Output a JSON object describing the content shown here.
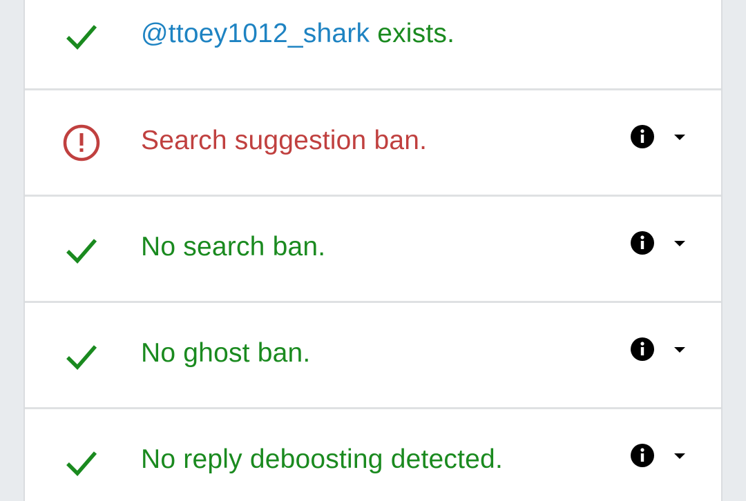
{
  "results": {
    "exists": {
      "status": "ok",
      "icon": "check-icon",
      "username": "@ttoey1012_shark",
      "text": " exists."
    },
    "items": [
      {
        "status": "bad",
        "icon": "alert-circle-icon",
        "text": "Search suggestion ban.",
        "info_icon": "info-icon",
        "expand_icon": "caret-down-icon"
      },
      {
        "status": "ok",
        "icon": "check-icon",
        "text": "No search ban.",
        "info_icon": "info-icon",
        "expand_icon": "caret-down-icon"
      },
      {
        "status": "ok",
        "icon": "check-icon",
        "text": "No ghost ban.",
        "info_icon": "info-icon",
        "expand_icon": "caret-down-icon"
      },
      {
        "status": "ok",
        "icon": "check-icon",
        "text": "No reply deboosting detected.",
        "info_icon": "info-icon",
        "expand_icon": "caret-down-icon"
      }
    ]
  },
  "colors": {
    "ok": "#1a8a1f",
    "bad": "#c0403f",
    "username": "#1e83c2",
    "divider": "#dfe1e3",
    "page_background": "#e8ebee"
  }
}
